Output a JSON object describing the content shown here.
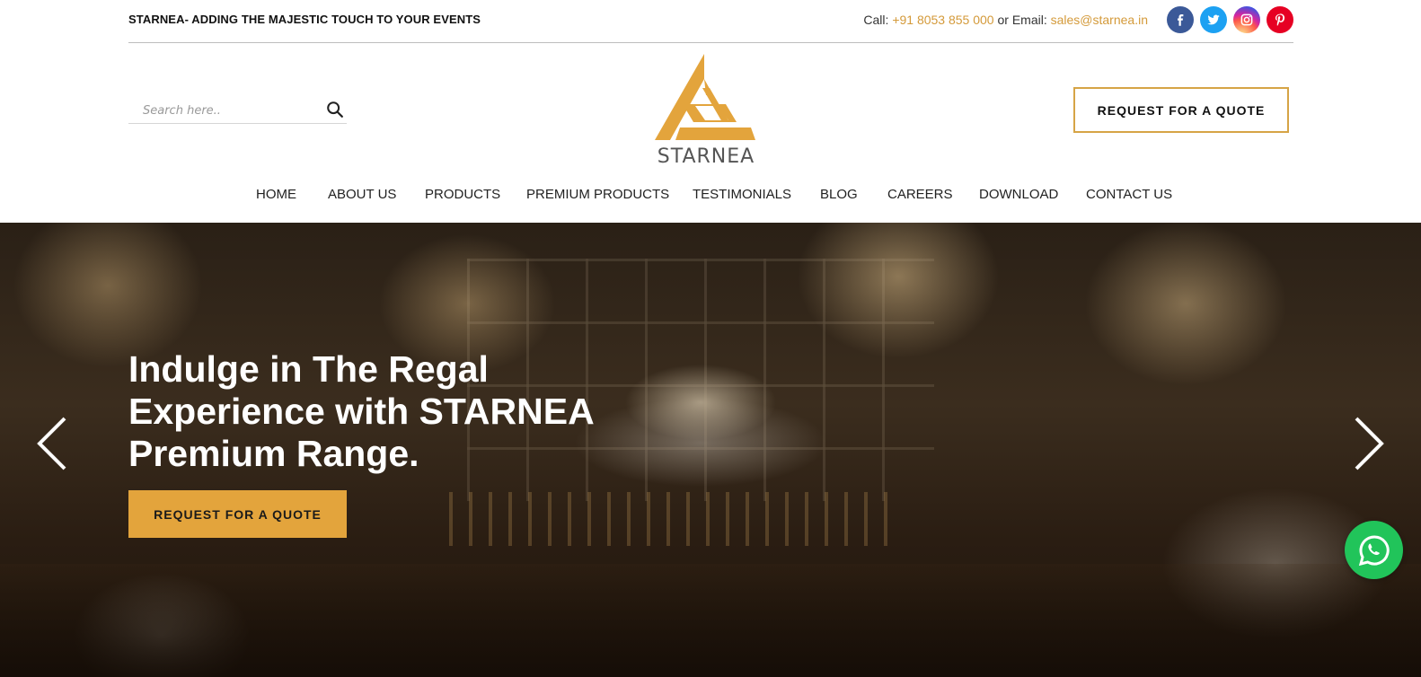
{
  "topbar": {
    "tagline": "STARNEA- ADDING THE MAJESTIC TOUCH TO YOUR EVENTS",
    "call_label": "Call: ",
    "phone": "+91 8053 855 000",
    "or_email_label": " or Email: ",
    "email": "sales@starnea.in",
    "social": [
      "facebook-icon",
      "twitter-icon",
      "instagram-icon",
      "pinterest-icon"
    ]
  },
  "header": {
    "search_placeholder": "Search here..",
    "logo_text": "STARNEA",
    "quote_button": "REQUEST FOR A QUOTE"
  },
  "nav": {
    "items": [
      "HOME",
      "ABOUT US",
      "PRODUCTS",
      "PREMIUM PRODUCTS",
      "TESTIMONIALS",
      "BLOG",
      "CAREERS",
      "DOWNLOAD",
      "CONTACT US"
    ]
  },
  "hero": {
    "title": "Indulge in The Regal Experience with STARNEA Premium Range.",
    "button": "REQUEST FOR A QUOTE"
  },
  "colors": {
    "brand_gold": "#e3a43c",
    "link_gold": "#d49a3a",
    "whatsapp_green": "#21c45a"
  }
}
